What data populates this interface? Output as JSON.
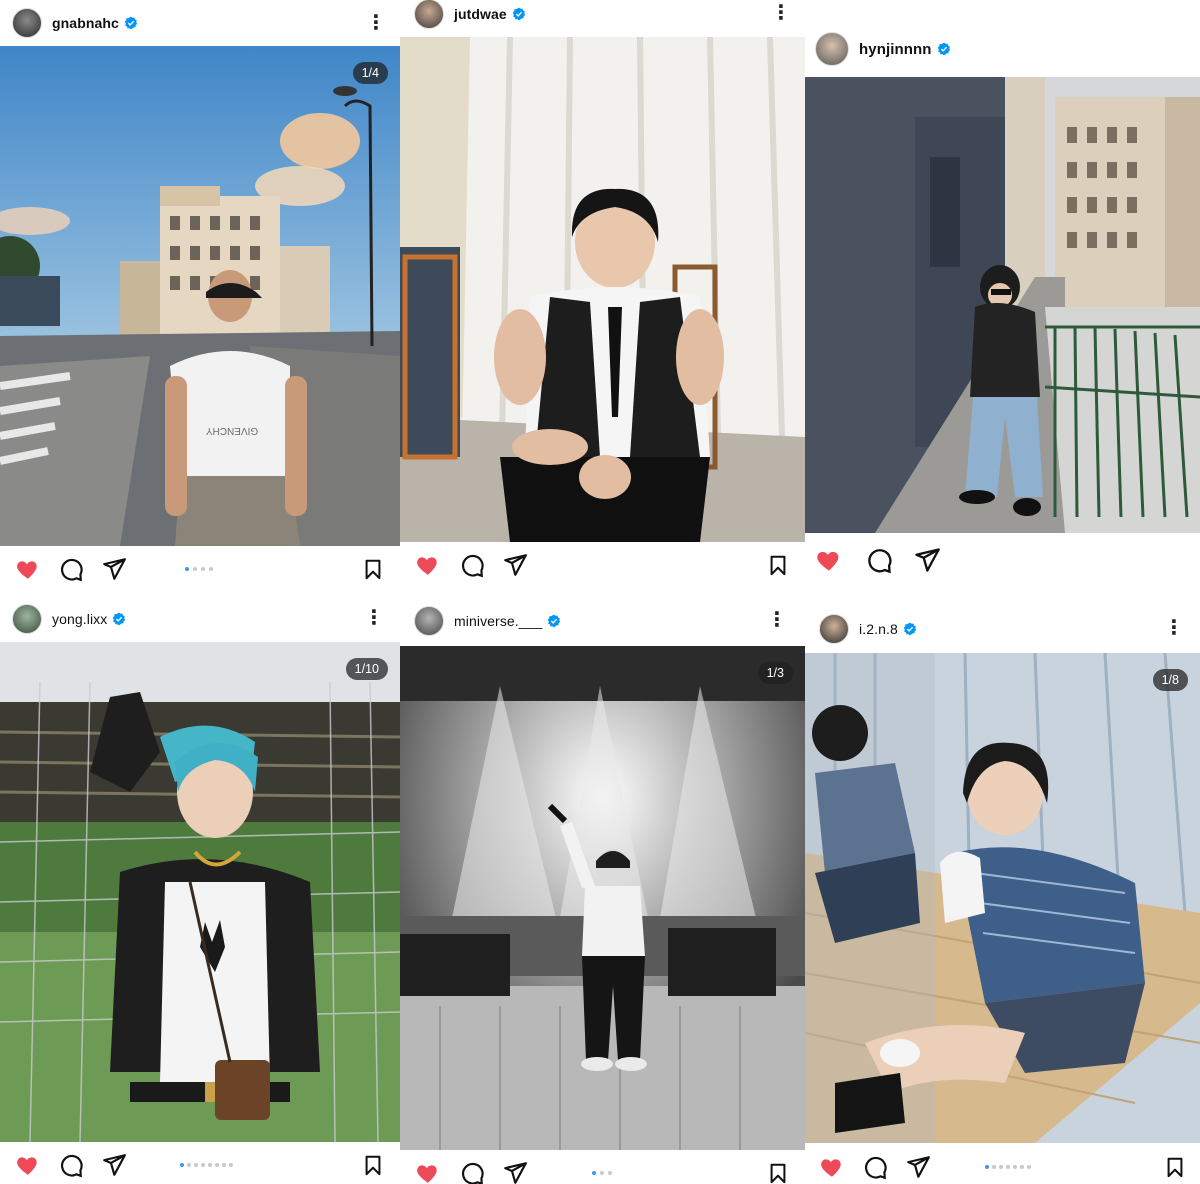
{
  "posts": [
    {
      "username": "gnabnahc",
      "verified": true,
      "counter": "1/4",
      "liked": true,
      "dots": 4,
      "active_dot": 0
    },
    {
      "username": "jutdwae",
      "verified": true,
      "counter": "",
      "liked": true,
      "dots": 0,
      "active_dot": 0
    },
    {
      "username": "hynjinnnn",
      "verified": true,
      "counter": "",
      "liked": true,
      "dots": 0,
      "active_dot": 0
    },
    {
      "username": "yong.lixx",
      "verified": true,
      "counter": "1/10",
      "liked": true,
      "dots": 10,
      "active_dot": 0
    },
    {
      "username": "miniverse.___",
      "verified": true,
      "counter": "1/3",
      "liked": true,
      "dots": 3,
      "active_dot": 0
    },
    {
      "username": "i.2.n.8",
      "verified": true,
      "counter": "1/8",
      "liked": true,
      "dots": 8,
      "active_dot": 0
    }
  ],
  "photo_text": {
    "shirt_brand": "GIVENCHY"
  },
  "icons": [
    "heart-icon",
    "comment-icon",
    "share-icon",
    "bookmark-icon",
    "more-options-icon",
    "verified-badge-icon"
  ],
  "colors": {
    "like": "#ed4956",
    "verified": "#0095f6",
    "dot_active": "#3897f0",
    "dot_inactive": "#c8c8c8"
  }
}
